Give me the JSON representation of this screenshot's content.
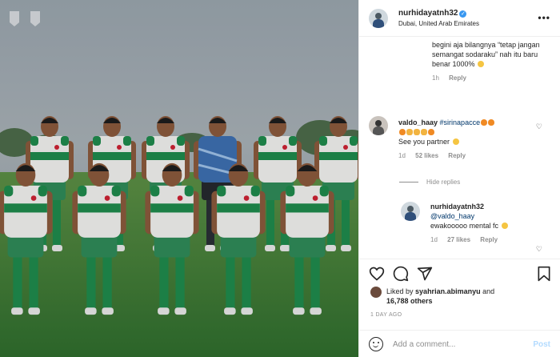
{
  "post": {
    "photo_logos": [
      "PSSI",
      "INDO"
    ]
  },
  "header": {
    "username": "nurhidayatnh32",
    "verified_mark": "✓",
    "location": "Dubai, United Arab Emirates",
    "more_icon": "•••"
  },
  "comments": [
    {
      "text": "begini aja bilangnya “tetap jangan semangat sodaraku” nah itu baru benar 1000%",
      "time": "1h",
      "reply_label": "Reply"
    },
    {
      "username": "valdo_haay",
      "mention": "#sirinapacce",
      "text": "See you partner",
      "time": "1d",
      "likes": "52 likes",
      "reply_label": "Reply"
    }
  ],
  "hide_replies_label": "Hide replies",
  "reply": {
    "username": "nurhidayatnh32",
    "mention": "@valdo_haay",
    "text": "ewakooooo mental fc",
    "time": "1d",
    "likes": "27 likes",
    "reply_label": "Reply"
  },
  "actions": {
    "liked_by_prefix": "Liked by",
    "liked_by_user": "syahrian.abimanyu",
    "liked_by_and": "and",
    "likes_count": "16,788 others",
    "time_ago": "1 DAY AGO"
  },
  "add_comment": {
    "placeholder": "Add a comment...",
    "post_label": "Post"
  },
  "colors": {
    "verified": "#3897f0",
    "jersey_white": "#f0f0ee",
    "jersey_green": "#1f8a4c",
    "keeper_blue": "#3d6fb0",
    "grass": "#3e8a3a"
  }
}
